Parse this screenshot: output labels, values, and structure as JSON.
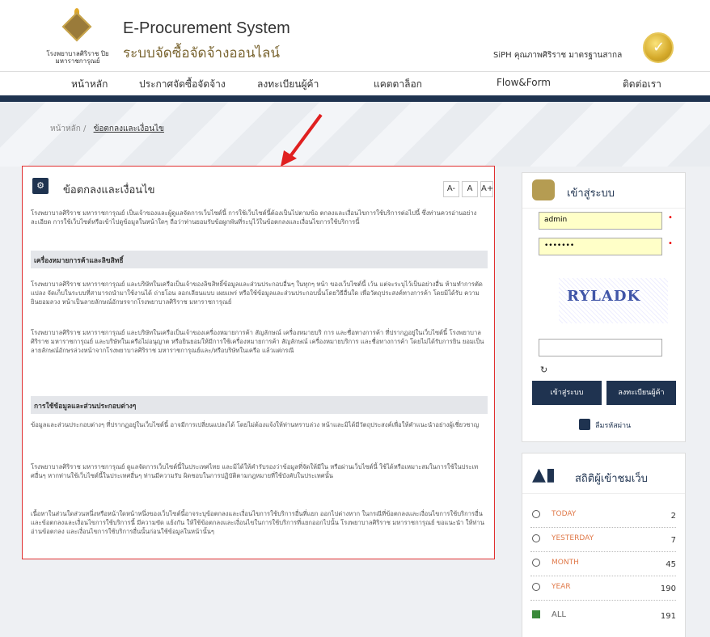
{
  "header": {
    "logo_text": "โรงพยาบาลศิริราช ปิยมหาราชการุณย์",
    "title_en": "E-Procurement System",
    "title_th": "ระบบจัดซื้อจัดจ้างออนไลน์",
    "siph_text": "SiPH คุณภาพศิริราช มาตรฐานสากล"
  },
  "nav": [
    "หน้าหลัก",
    "ประกาศจัดซื้อจัดจ้าง",
    "ลงทะเบียนผู้ค้า",
    "แคตตาล็อก",
    "Flow&Form",
    "ติดต่อเรา"
  ],
  "breadcrumb": {
    "home": "หน้าหลัก",
    "sep": "/",
    "current": "ข้อตกลงและเงื่อนไข"
  },
  "panel": {
    "title": "ข้อตกลงและเงื่อนไข",
    "font_buttons": [
      "A-",
      "A",
      "A+"
    ],
    "intro": "โรงพยาบาลศิริราช มหาราชการุณย์ เป็นเจ้าของและผู้ดูแลจัดการเว็บไซต์นี้ การใช้เว็บไซต์นี้ต้องเป็นไปตามข้อ ตกลงและเงื่อนไขการใช้บริการต่อไปนี้ ซึ่งท่านควรอ่านอย่างละเอียด การใช้เว็บไซต์หรือเข้าไปดูข้อมูลในหน้าใดๆ ถือว่าท่านยอมรับข้อผูกพันที่ระบุไว้ในข้อตกลงและเงื่อนไขการใช้บริการนี้",
    "section1": "เครื่องหมายการค้าและลิขสิทธิ์",
    "p1": "โรงพยาบาลศิริราช มหาราชการุณย์ และบริษัทในเครือเป็นเจ้าของลิขสิทธิ์ข้อมูลและส่วนประกอบอื่นๆ ในทุกๆ หน้า ของเว็บไซต์นี้ เว้น แต่จะระบุไว้เป็นอย่างอื่น ห้ามทำการตัดแปลง จัดเก็บในระบบที่สามารถนำมาใช้งานได้ ถ่ายโอน ลอกเลียนแบบ เผยแพร่ หรือใช้ข้อมูลและส่วนประกอบนั้นโดยวิธีอื่นใด เพื่อวัตถุประสงค์ทางการค้า โดยมิได้รับ ความยินยอมลวง หน้าเป็นลายลักษณ์อักษรจากโรงพยาบาลศิริราช มหาราชการุณย์",
    "p2": "โรงพยาบาลศิริราช มหาราชการุณย์ และบริษัทในเครือเป็นเจ้าของเครื่องหมายการค้า สัญลักษณ์ เครื่องหมายบริ การ และชื่อทางการค้า ที่ปรากฏอยู่ในเว็บไซต์นี้ โรงพยาบาลศิริราช มหาราชการุณย์ และบริษัทในเครือไม่อนุญาต หรือยินยอมให้มีการใช้เครื่องหมายการค้า สัญลักษณ์ เครื่องหมายบริการ และชื่อทางการค้า โดยไม่ได้รับการยิน ยอมเป็นลายลักษณ์อักษรล่วงหน้าจากโรงพยาบาลศิริราช มหาราชการุณย์และ/หรือบริษัทในเครือ แล้วแต่กรณี",
    "section2": "การใช้ข้อมูลและส่วนประกอบต่างๆ",
    "p3": "ข้อมูลและส่วนประกอบต่างๆ ที่ปรากฏอยู่ในเว็บไซต์นี้ อาจมีการเปลี่ยนแปลงได้ โดยไม่ต้องแจ้งให้ท่านทราบล่วง หน้าและมิได้มีวัตถุประสงค์เพื่อให้คำแนะนำอย่างผู้เชี่ยวชาญ",
    "p4": "โรงพยาบาลศิริราช มหาราชการุณย์ ดูแลจัดการเว็บไซต์นี้ในประเทศไทย และมิได้ให้คำรับรองว่าข้อมูลที่จัดให้มีใน หรือผ่านเว็บไซต์นี้ ใช้ได้หรือเหมาะสมในการใช้ในประเทศอื่นๆ หากท่านใช้เว็บไซต์นี้ในประเทศอื่นๆ ท่านมีความรับ ผิดชอบในการปฏิบัติตามกฎหมายที่ใช้บังคับในประเทศนั้น",
    "p5": "เนื้อหาในส่วนใดส่วนหนึ่งหรือหน้าใดหน้าหนึ่งของเว็บไซต์นี้อาจระบุข้อตกลงและเงื่อนไขการใช้บริการอื่นที่แยก ออกไปต่างหาก ในกรณีที่ข้อตกลงและเงื่อนไขการใช้บริการอื่นและข้อตกลงและเงื่อนไขการใช้บริการนี้ มีความขัด แย้งกัน ให้ใช้ข้อตกลงและเงื่อนไขในการใช้บริการที่แยกออกไปนั้น โรงพยาบาลศิริราช มหาราชการุณย์ ขอแนะนำ ให้ท่านอ่านข้อตกลง และเงื่อนไขการใช้บริการอื่นนั้นก่อนใช้ข้อมูลในหน้านั้นๆ"
  },
  "login": {
    "title": "เข้าสู่ระบบ",
    "username": "admin",
    "password": "•••••••",
    "captcha": "RYLADK",
    "login_btn": "เข้าสู่ระบบ",
    "register_btn": "ลงทะเบียนผู้ค้า",
    "forgot": "ลืมรหัสผ่าน"
  },
  "stats": {
    "title": "สถิติผู้เข้าชมเว็บ",
    "rows": [
      {
        "label": "TODAY",
        "value": "2"
      },
      {
        "label": "YESTERDAY",
        "value": "7"
      },
      {
        "label": "MONTH",
        "value": "45"
      },
      {
        "label": "YEAR",
        "value": "190"
      },
      {
        "label": "ALL",
        "value": "191"
      }
    ]
  }
}
